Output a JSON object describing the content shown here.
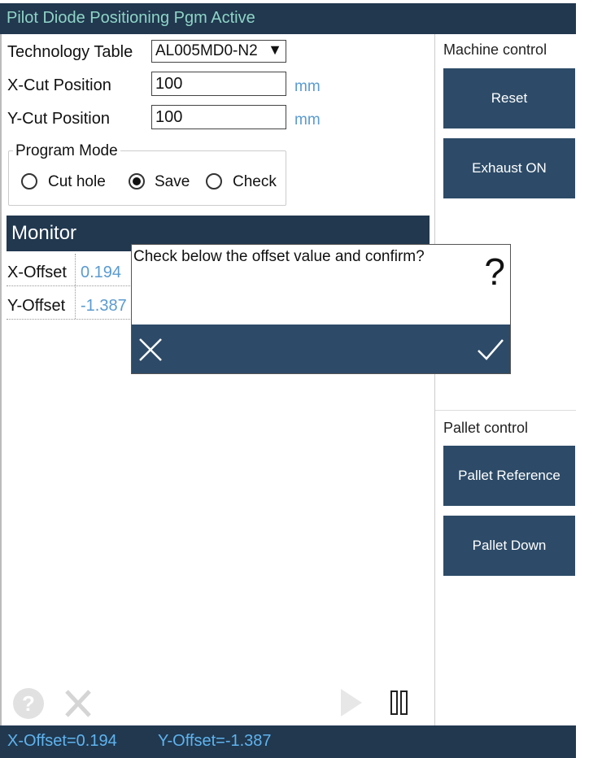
{
  "title": "Pilot Diode Positioning Pgm Active",
  "form": {
    "tech_table_label": "Technology Table",
    "tech_table_value": "AL005MD0-N2",
    "xcut_label": "X-Cut Position",
    "xcut_value": "100",
    "ycut_label": "Y-Cut Position",
    "ycut_value": "100",
    "unit": "mm"
  },
  "program_mode": {
    "title": "Program Mode",
    "options": [
      "Cut hole",
      "Save",
      "Check"
    ],
    "selected": "Save"
  },
  "monitor": {
    "title": "Monitor",
    "rows": [
      {
        "label": "X-Offset",
        "value": "0.194"
      },
      {
        "label": "Y-Offset",
        "value": "-1.387"
      }
    ]
  },
  "dialog": {
    "message": "Check below the offset value and confirm?",
    "question_mark": "?"
  },
  "machine_control": {
    "title": "Machine control",
    "buttons": [
      "Reset",
      "Exhaust ON"
    ]
  },
  "pallet_control": {
    "title": "Pallet control",
    "buttons": [
      "Pallet Reference",
      "Pallet Down"
    ]
  },
  "status": {
    "x": "X-Offset=0.194",
    "y": "Y-Offset=-1.387"
  },
  "colors": {
    "header_bg": "#21384f",
    "button_bg": "#2d4b68",
    "title_text": "#8fd4c6",
    "unit_text": "#5a9bd0",
    "status_text": "#5fb3ee"
  },
  "icons": [
    "help-icon",
    "cancel-x-icon",
    "play-icon",
    "pause-icon",
    "close-icon",
    "check-icon"
  ]
}
